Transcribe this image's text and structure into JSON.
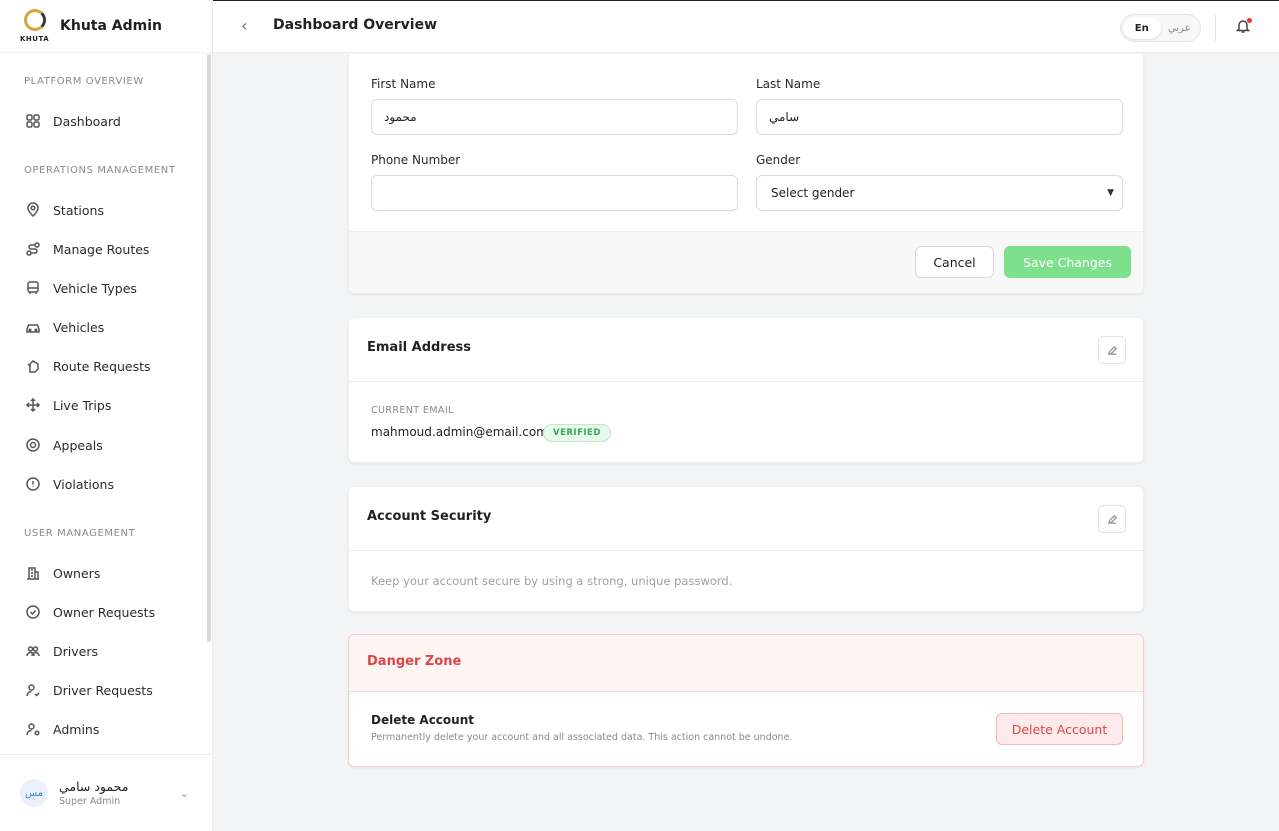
{
  "brand": {
    "title": "Khuta Admin",
    "logo_text": "KHUTA"
  },
  "header": {
    "title": "Dashboard Overview",
    "lang_en": "En",
    "lang_ar": "عربي"
  },
  "sidebar": {
    "sections": [
      {
        "title": "PLATFORM OVERVIEW",
        "items": [
          {
            "label": "Dashboard",
            "icon": "grid-icon"
          }
        ]
      },
      {
        "title": "OPERATIONS MANAGEMENT",
        "items": [
          {
            "label": "Stations",
            "icon": "location-pin-icon"
          },
          {
            "label": "Manage Routes",
            "icon": "route-icon"
          },
          {
            "label": "Vehicle Types",
            "icon": "bus-icon"
          },
          {
            "label": "Vehicles",
            "icon": "car-icon"
          },
          {
            "label": "Route Requests",
            "icon": "hand-icon"
          },
          {
            "label": "Live Trips",
            "icon": "move-icon"
          },
          {
            "label": "Appeals",
            "icon": "support-icon"
          },
          {
            "label": "Violations",
            "icon": "alert-circle-icon"
          }
        ]
      },
      {
        "title": "USER MANAGEMENT",
        "items": [
          {
            "label": "Owners",
            "icon": "building-icon"
          },
          {
            "label": "Owner Requests",
            "icon": "check-circle-icon"
          },
          {
            "label": "Drivers",
            "icon": "users-icon"
          },
          {
            "label": "Driver Requests",
            "icon": "user-check-icon"
          },
          {
            "label": "Admins",
            "icon": "user-gear-icon"
          }
        ]
      }
    ],
    "user": {
      "avatar": "مس",
      "name": "محمود سامي",
      "role": "Super Admin"
    }
  },
  "form": {
    "first_name_label": "First Name",
    "first_name_value": "محمود",
    "last_name_label": "Last Name",
    "last_name_value": "سامي",
    "phone_label": "Phone Number",
    "phone_value": "",
    "gender_label": "Gender",
    "gender_value": "Select gender",
    "cancel_label": "Cancel",
    "save_label": "Save Changes"
  },
  "email": {
    "title": "Email Address",
    "current_label": "CURRENT EMAIL",
    "current_value": "mahmoud.admin@email.com",
    "badge": "VERIFIED"
  },
  "security": {
    "title": "Account Security",
    "description": "Keep your account secure by using a strong, unique password."
  },
  "danger": {
    "title": "Danger Zone",
    "delete_title": "Delete Account",
    "delete_desc": "Permanently delete your account and all associated data. This action cannot be undone.",
    "delete_button": "Delete Account"
  },
  "colors": {
    "accent_green": "#7ee08d",
    "danger": "#e04545",
    "verified": "#35a853"
  }
}
